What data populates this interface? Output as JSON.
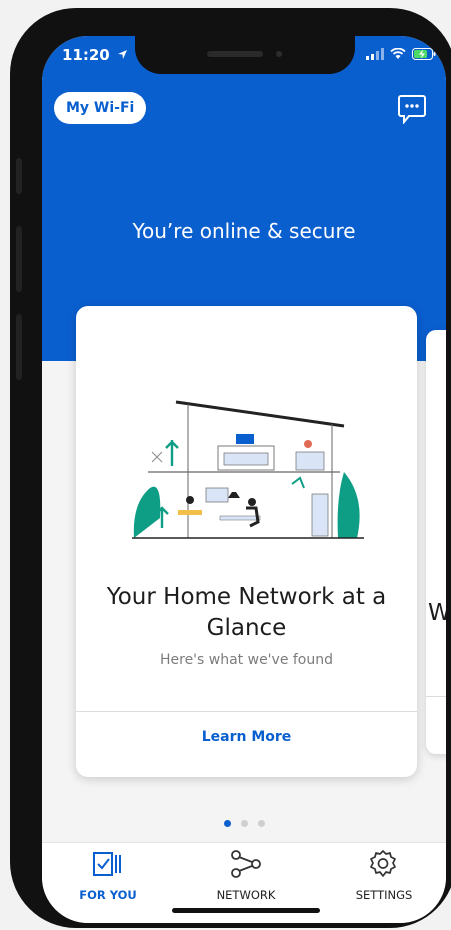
{
  "status_bar": {
    "time": "11:20"
  },
  "header": {
    "wifi_label": "My Wi-Fi",
    "status_text": "You’re online & secure"
  },
  "card": {
    "title": "Your Home Network at a Glance",
    "subtitle": "Here's what we've found",
    "link_label": "Learn More"
  },
  "next_card": {
    "title_fragment": "W"
  },
  "pager": {
    "count": 3,
    "active_index": 0
  },
  "tabs": [
    {
      "label": "FOR YOU",
      "icon": "checklist-icon",
      "active": true
    },
    {
      "label": "NETWORK",
      "icon": "network-nodes-icon",
      "active": false
    },
    {
      "label": "SETTINGS",
      "icon": "gear-icon",
      "active": false
    }
  ],
  "colors": {
    "brand_blue": "#0a5fcf",
    "background": "#f4f4f4",
    "teal_plant": "#0e9e86"
  }
}
